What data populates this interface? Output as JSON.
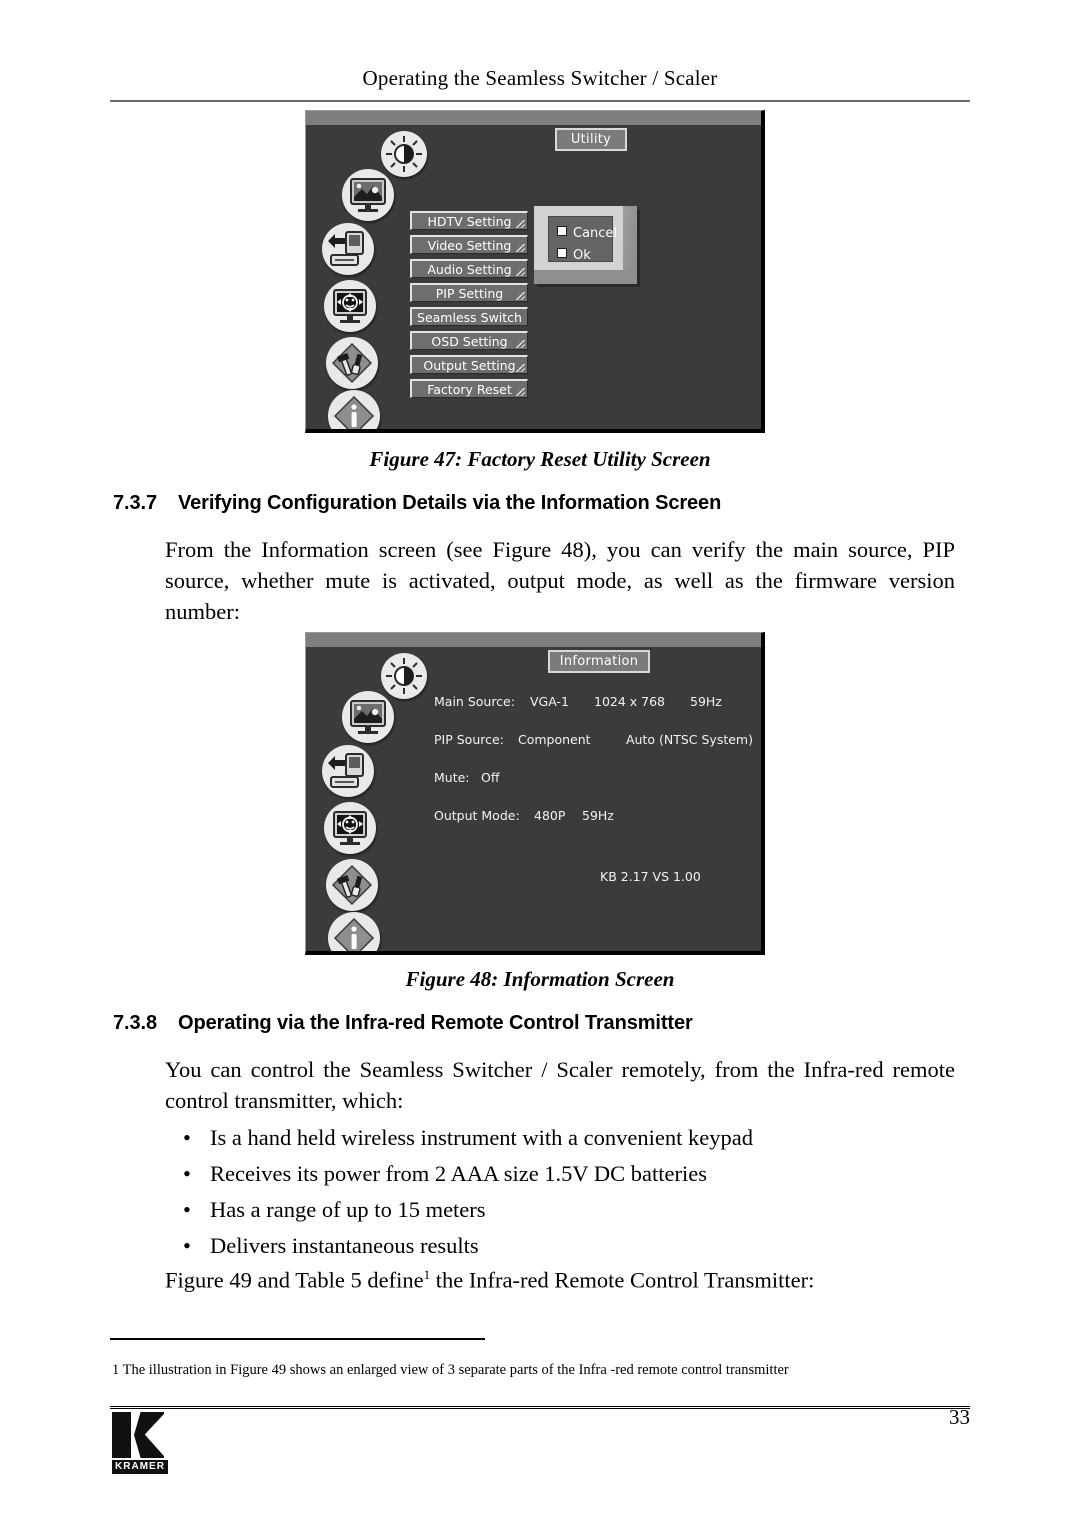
{
  "header": {
    "running_title": "Operating the Seamless Switcher / Scaler"
  },
  "figure47": {
    "caption": "Figure 47: Factory Reset Utility Screen",
    "title": "Utility",
    "sidebar_icons": [
      "brightness-contrast-icon",
      "picture-monitor-icon",
      "input-source-icon",
      "osd-face-icon",
      "tools-setup-icon",
      "information-icon"
    ],
    "menu_items": [
      "HDTV Setting",
      "Video Setting",
      "Audio Setting",
      "PIP Setting",
      "Seamless Switch",
      "OSD Setting",
      "Output Setting",
      "Factory Reset"
    ],
    "dialog": {
      "options": [
        "Cancel",
        "Ok"
      ]
    }
  },
  "section737": {
    "number": "7.3.7",
    "title": "Verifying Configuration Details via the Information Screen",
    "paragraph": "From the Information screen (see Figure 48), you can verify the main source, PIP source, whether mute is activated, output mode, as well as the firmware version number:"
  },
  "figure48": {
    "caption": "Figure 48: Information Screen",
    "title": "Information",
    "sidebar_icons": [
      "brightness-contrast-icon",
      "picture-monitor-icon",
      "input-source-icon",
      "osd-face-icon",
      "tools-setup-icon",
      "information-icon"
    ],
    "rows": [
      {
        "label": "Main Source:",
        "value": "VGA-1",
        "extra1": "1024 x 768",
        "extra2": "59Hz"
      },
      {
        "label": "PIP Source:",
        "value": "Component",
        "extra1": "",
        "extra2": "Auto (NTSC System)"
      },
      {
        "label": "Mute:",
        "value": "Off",
        "extra1": "",
        "extra2": ""
      },
      {
        "label": "Output Mode:",
        "value": "480P",
        "extra1": "59Hz",
        "extra2": ""
      }
    ],
    "version": "KB 2.17   VS 1.00"
  },
  "section738": {
    "number": "7.3.8",
    "title": "Operating via the Infra-red Remote Control Transmitter",
    "paragraph": "You can control the Seamless Switcher / Scaler remotely, from the Infra-red remote control transmitter, which:",
    "bullets": [
      "Is a hand held wireless instrument with a convenient keypad",
      "Receives its power from 2 AAA size 1.5V DC batteries",
      "Has a range of up to 15 meters",
      "Delivers instantaneous results"
    ],
    "bullet_glyph": "•",
    "closing_pre": "Figure 49 and Table 5 define",
    "closing_sup": "1",
    "closing_post": " the Infra-red Remote Control Transmitter:"
  },
  "footnote": {
    "text": "1 The illustration in Figure 49 shows an enlarged view of 3 separate parts of the Infra -red remote control transmitter"
  },
  "footer": {
    "page_number": "33",
    "logo_name": "KRAMER"
  }
}
